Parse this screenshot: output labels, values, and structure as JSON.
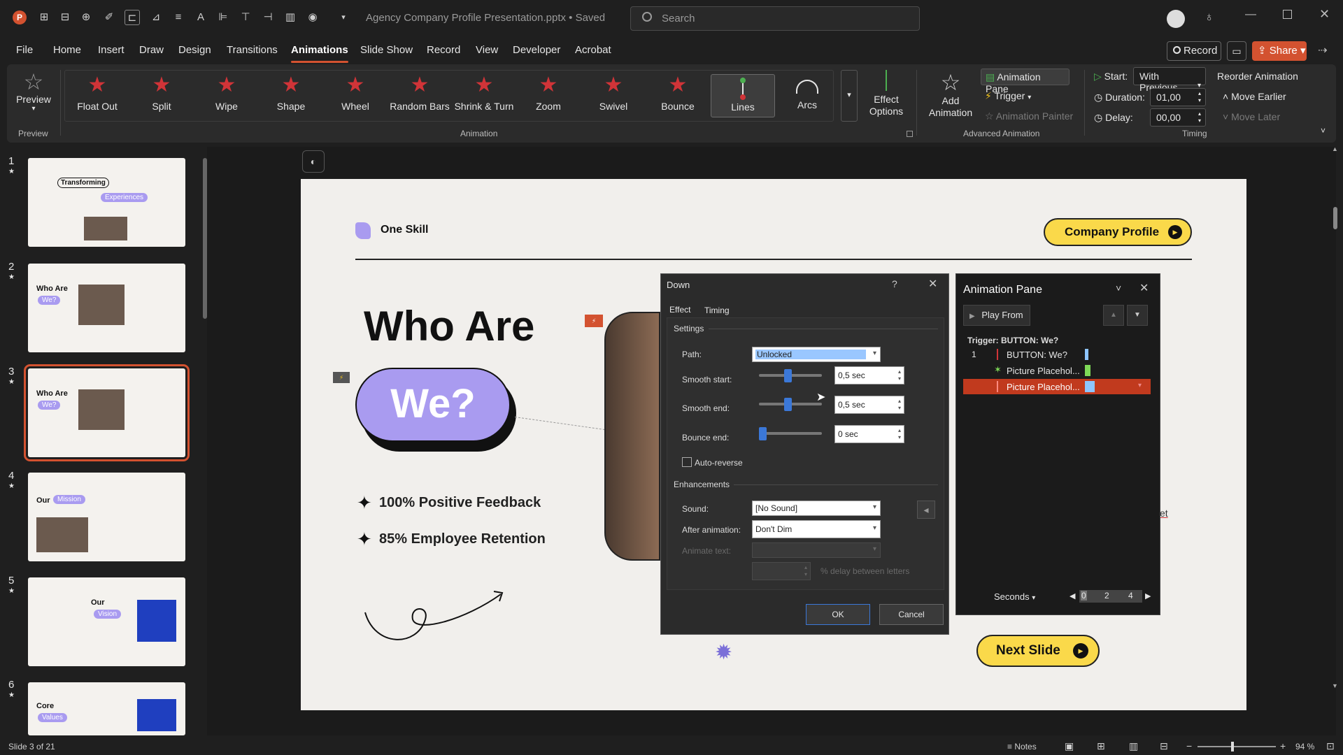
{
  "app": {
    "document_title": "Agency Company Profile Presentation.pptx • Saved",
    "search_placeholder": "Search"
  },
  "menu": [
    "File",
    "Home",
    "Insert",
    "Draw",
    "Design",
    "Transitions",
    "Animations",
    "Slide Show",
    "Record",
    "View",
    "Developer",
    "Acrobat"
  ],
  "menu_active": "Animations",
  "header_buttons": {
    "record": "Record",
    "share": "Share"
  },
  "ribbon": {
    "preview": "Preview",
    "preview_group": "Preview",
    "gallery": [
      "Float Out",
      "Split",
      "Wipe",
      "Shape",
      "Wheel",
      "Random Bars",
      "Shrink & Turn",
      "Zoom",
      "Swivel",
      "Bounce",
      "Lines",
      "Arcs"
    ],
    "gallery_selected": "Lines",
    "effect_options": "Effect Options",
    "animation_group": "Animation",
    "add_animation": "Add Animation",
    "animation_pane": "Animation Pane",
    "trigger": "Trigger",
    "animation_painter": "Animation Painter",
    "advanced_group": "Advanced Animation",
    "start_label": "Start:",
    "start_value": "With Previous",
    "duration_label": "Duration:",
    "duration_value": "01,00",
    "delay_label": "Delay:",
    "delay_value": "00,00",
    "timing_group": "Timing",
    "reorder": "Reorder Animation",
    "move_earlier": "Move Earlier",
    "move_later": "Move Later"
  },
  "slides": [
    {
      "num": "1",
      "title": "Transforming",
      "pill": "Experiences"
    },
    {
      "num": "2",
      "title": "Who Are",
      "pill": "We?"
    },
    {
      "num": "3",
      "title": "Who Are",
      "pill": "We?"
    },
    {
      "num": "4",
      "title": "Our",
      "pill": "Mission"
    },
    {
      "num": "5",
      "title": "Our",
      "pill": "Vision"
    },
    {
      "num": "6",
      "title": "Core",
      "pill": "Values"
    }
  ],
  "slide": {
    "brand": "One Skill",
    "company_profile": "Company Profile",
    "heading": "Who Are",
    "pill": "We?",
    "bullet1": "100% Positive Feedback",
    "bullet2": "85% Employee Retention",
    "next_slide": "Next Slide",
    "partial_text": "et"
  },
  "dialog": {
    "title": "Down",
    "help": "?",
    "tab_effect": "Effect",
    "tab_timing": "Timing",
    "settings": "Settings",
    "path_label": "Path:",
    "path_value": "Unlocked",
    "smooth_start_label": "Smooth start:",
    "smooth_start_value": "0,5 sec",
    "smooth_end_label": "Smooth end:",
    "smooth_end_value": "0,5 sec",
    "bounce_end_label": "Bounce end:",
    "bounce_end_value": "0 sec",
    "auto_reverse": "Auto-reverse",
    "enhancements": "Enhancements",
    "sound_label": "Sound:",
    "sound_value": "[No Sound]",
    "after_label": "After animation:",
    "after_value": "Don't Dim",
    "animate_text_label": "Animate text:",
    "delay_letters": "% delay between letters",
    "ok": "OK",
    "cancel": "Cancel"
  },
  "pane": {
    "title": "Animation Pane",
    "play_from": "Play From",
    "trigger": "Trigger: BUTTON: We?",
    "items": [
      {
        "num": "1",
        "label": "BUTTON: We?",
        "color": "#8ec5ff"
      },
      {
        "num": "",
        "label": "Picture Placehol...",
        "color": "#7ed957"
      },
      {
        "num": "",
        "label": "Picture Placehol...",
        "color": "#8ec5ff"
      }
    ],
    "seconds": "Seconds",
    "ticks": [
      "0",
      "2",
      "4"
    ]
  },
  "status": {
    "slide_info": "Slide 3 of 21",
    "notes": "Notes",
    "zoom": "94 %"
  },
  "colors": {
    "accent": "#d35230",
    "pill_purple": "#a99bf0",
    "button_yellow": "#fad94a",
    "selected_row": "#c13a1e"
  }
}
